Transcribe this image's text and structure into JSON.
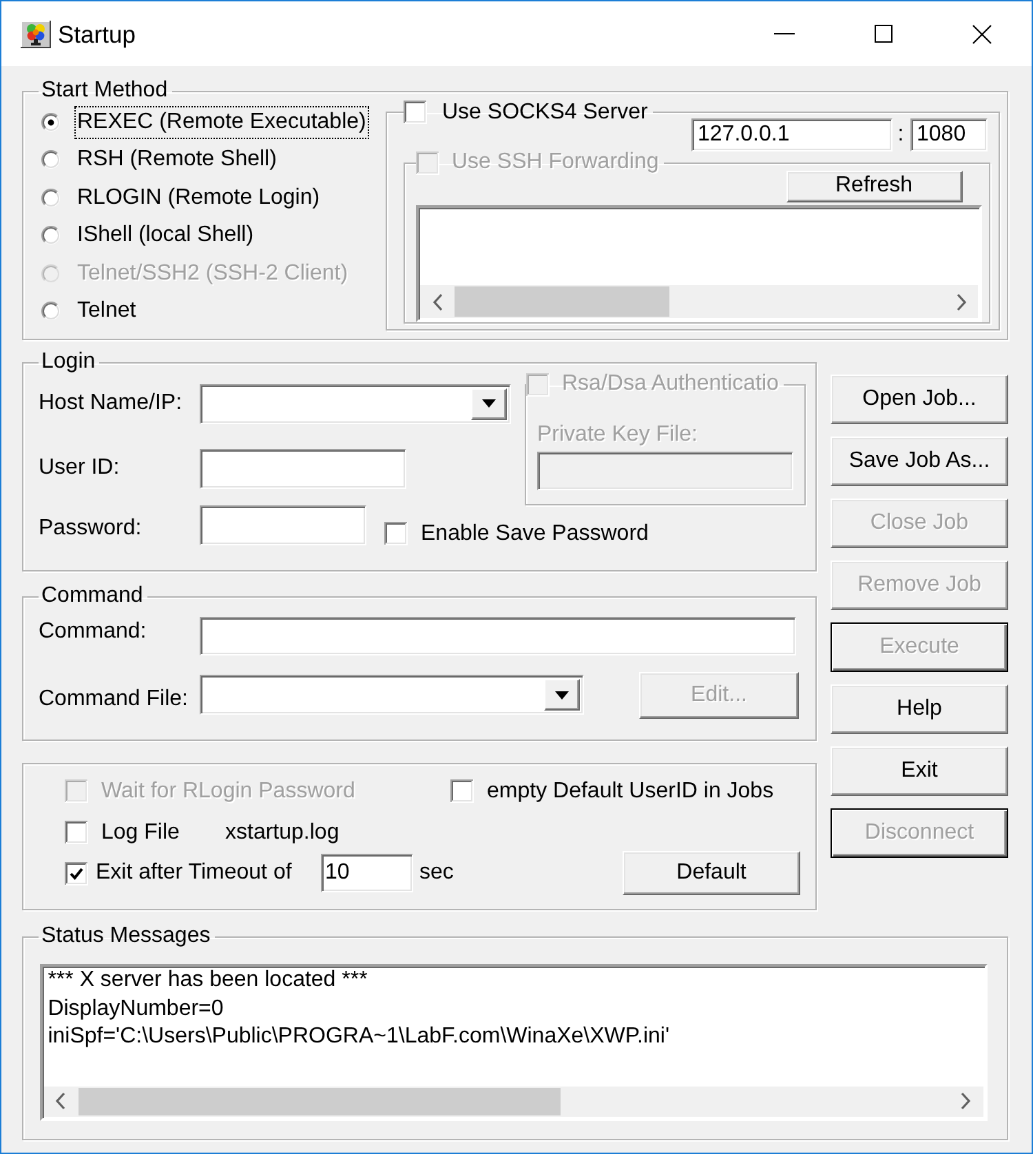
{
  "window": {
    "title": "Startup"
  },
  "start_method": {
    "label": "Start Method",
    "options": [
      {
        "label": "REXEC (Remote Executable)",
        "selected": true,
        "disabled": false,
        "focused": true
      },
      {
        "label": "RSH (Remote Shell)",
        "selected": false,
        "disabled": false,
        "focused": false
      },
      {
        "label": "RLOGIN (Remote Login)",
        "selected": false,
        "disabled": false,
        "focused": false
      },
      {
        "label": "IShell (local Shell)",
        "selected": false,
        "disabled": false,
        "focused": false
      },
      {
        "label": "Telnet/SSH2 (SSH-2 Client)",
        "selected": false,
        "disabled": true,
        "focused": false
      },
      {
        "label": "Telnet",
        "selected": false,
        "disabled": false,
        "focused": false
      }
    ]
  },
  "socks": {
    "label": "Use SOCKS4 Server",
    "checked": false,
    "disabled": false,
    "host": "127.0.0.1",
    "separator": ":",
    "port": "1080",
    "ssh_forwarding": {
      "label": "Use SSH Forwarding",
      "checked": false,
      "disabled": true,
      "refresh_button": "Refresh"
    }
  },
  "login": {
    "label": "Login",
    "host_label": "Host Name/IP:",
    "user_label": "User ID:",
    "password_label": "Password:",
    "save_password": {
      "label": "Enable Save Password",
      "checked": false,
      "disabled": false
    },
    "rsa": {
      "label": "Rsa/Dsa Authenticatio",
      "checked": false,
      "disabled": true,
      "key_file_label": "Private Key File:"
    }
  },
  "command": {
    "label": "Command",
    "command_label": "Command:",
    "file_label": "Command File:",
    "edit_button": {
      "label": "Edit...",
      "disabled": true
    }
  },
  "options": {
    "wait_rlogin_password": {
      "label": "Wait for RLogin Password",
      "checked": false,
      "disabled": true
    },
    "empty_default_userid": {
      "label": "empty Default UserID in Jobs",
      "checked": false,
      "disabled": false
    },
    "log_file": {
      "label": "Log File",
      "checked": false,
      "disabled": false,
      "file_name": "xstartup.log"
    },
    "exit_after_timeout": {
      "label": "Exit after Timeout of",
      "checked": true,
      "disabled": false,
      "value": "10",
      "unit": "sec"
    },
    "default_button": "Default"
  },
  "buttons": [
    {
      "label": "Open Job...",
      "disabled": false,
      "default": false
    },
    {
      "label": "Save Job As...",
      "disabled": false,
      "default": false
    },
    {
      "label": "Close Job",
      "disabled": true,
      "default": false
    },
    {
      "label": "Remove Job",
      "disabled": true,
      "default": false
    },
    {
      "label": "Execute",
      "disabled": true,
      "default": true
    },
    {
      "label": "Help",
      "disabled": false,
      "default": false
    },
    {
      "label": "Exit",
      "disabled": false,
      "default": false
    },
    {
      "label": "Disconnect",
      "disabled": true,
      "default": true
    }
  ],
  "status": {
    "label": "Status Messages",
    "lines": [
      "*** X server has been located ***",
      "DisplayNumber=0",
      "iniSpf='C:\\Users\\Public\\PROGRA~1\\LabF.com\\WinaXe\\XWP.ini'"
    ]
  }
}
